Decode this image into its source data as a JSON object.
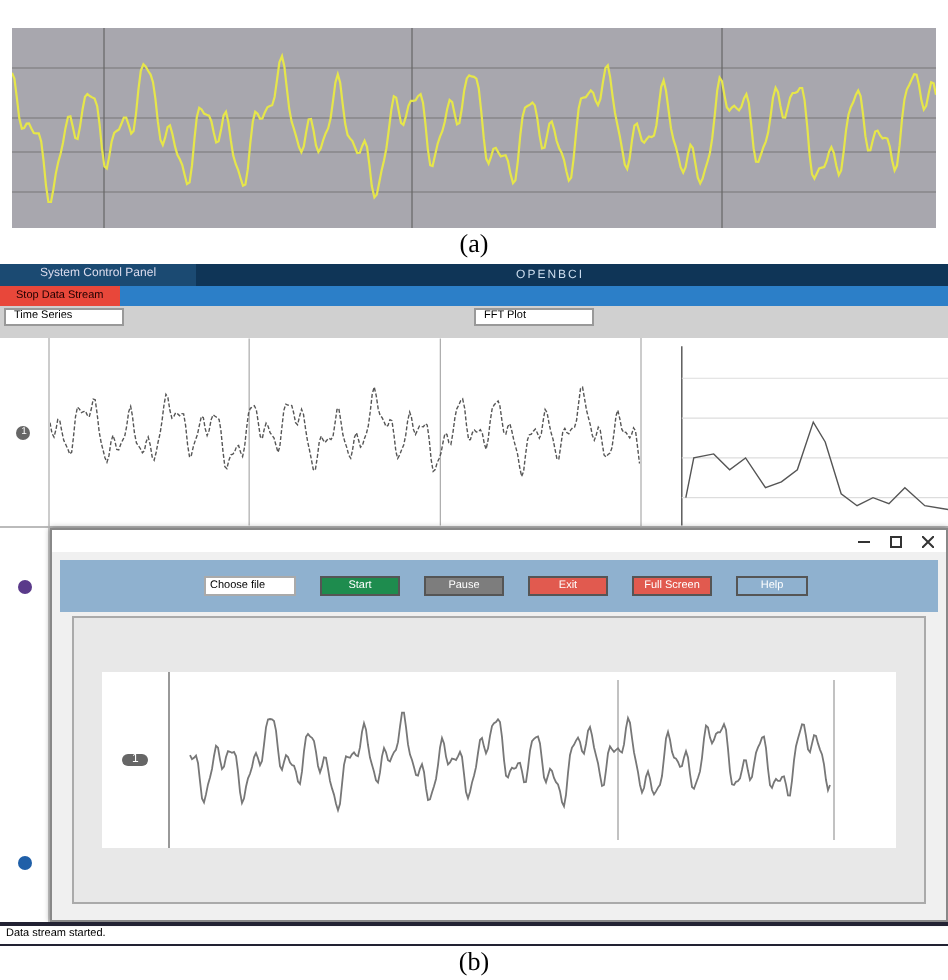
{
  "figure_a": {
    "caption": "(a)"
  },
  "app": {
    "header_title": "System Control Panel",
    "logo": "OPENBCI",
    "stop_button": "Stop Data Stream",
    "widget_left": "Time Series",
    "widget_right": "FFT Plot",
    "channel_badge": "1",
    "popup": {
      "file_select": "Choose file",
      "buttons": [
        {
          "label": "Start",
          "kind": "start"
        },
        {
          "label": "Pause",
          "kind": "pause"
        },
        {
          "label": "Exit",
          "kind": "stop"
        },
        {
          "label": "Full Screen",
          "kind": "stop"
        },
        {
          "label": "Help",
          "kind": "outline"
        }
      ],
      "channel_badge": "1"
    },
    "status": "Data stream started."
  },
  "figure_b": {
    "caption": "(b)"
  }
}
